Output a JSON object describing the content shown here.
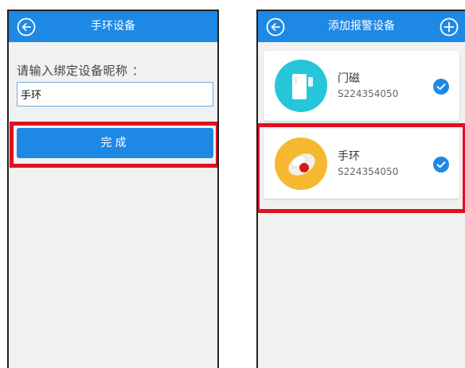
{
  "left_screen": {
    "title": "手环设备",
    "prompt_label": "请输入绑定设备昵称 ：",
    "nickname_value": "手环",
    "done_label": "完成"
  },
  "right_screen": {
    "title": "添加报警设备",
    "devices": [
      {
        "name": "门磁",
        "serial": "S224354050",
        "icon": "door-sensor-icon",
        "icon_bg": "#26c6da",
        "checked": true
      },
      {
        "name": "手环",
        "serial": "S224354050",
        "icon": "wristband-icon",
        "icon_bg": "#f6b830",
        "checked": true
      }
    ]
  },
  "colors": {
    "header_blue": "#1e88e5",
    "highlight_red": "#e01020",
    "check_blue": "#1e88e5"
  }
}
